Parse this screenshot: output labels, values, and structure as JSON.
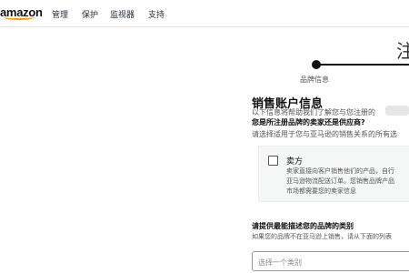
{
  "header": {
    "logo": "amazon",
    "nav": [
      "管理",
      "保护",
      "监视器",
      "支持"
    ]
  },
  "progress": {
    "title_fragment": "注",
    "current_step_label": "品牌信息"
  },
  "sales_account": {
    "title": "销售账户信息",
    "description": "以下信息将帮助我们了解您与您注册的",
    "question": "您是所注册品牌的卖家还是供应商?",
    "instruction": "请选择适用于您与亚马逊的销售关系的所有选"
  },
  "seller_option": {
    "label": "卖方",
    "checked": false,
    "desc_lines": [
      "卖家直接向客户销售他们的产品，自行",
      "亚马逊物流配送订单。您销售品牌产品",
      "市场都需要您的卖家信息"
    ]
  },
  "brand_category": {
    "title": "请提供最能描述您的品牌的类别",
    "help": "如果您的品牌不在亚马逊上销售，请从下面的列表",
    "select_placeholder": "选择一个类别"
  },
  "colors": {
    "accent": "#ff9900",
    "text": "#111111",
    "muted": "#555555"
  }
}
